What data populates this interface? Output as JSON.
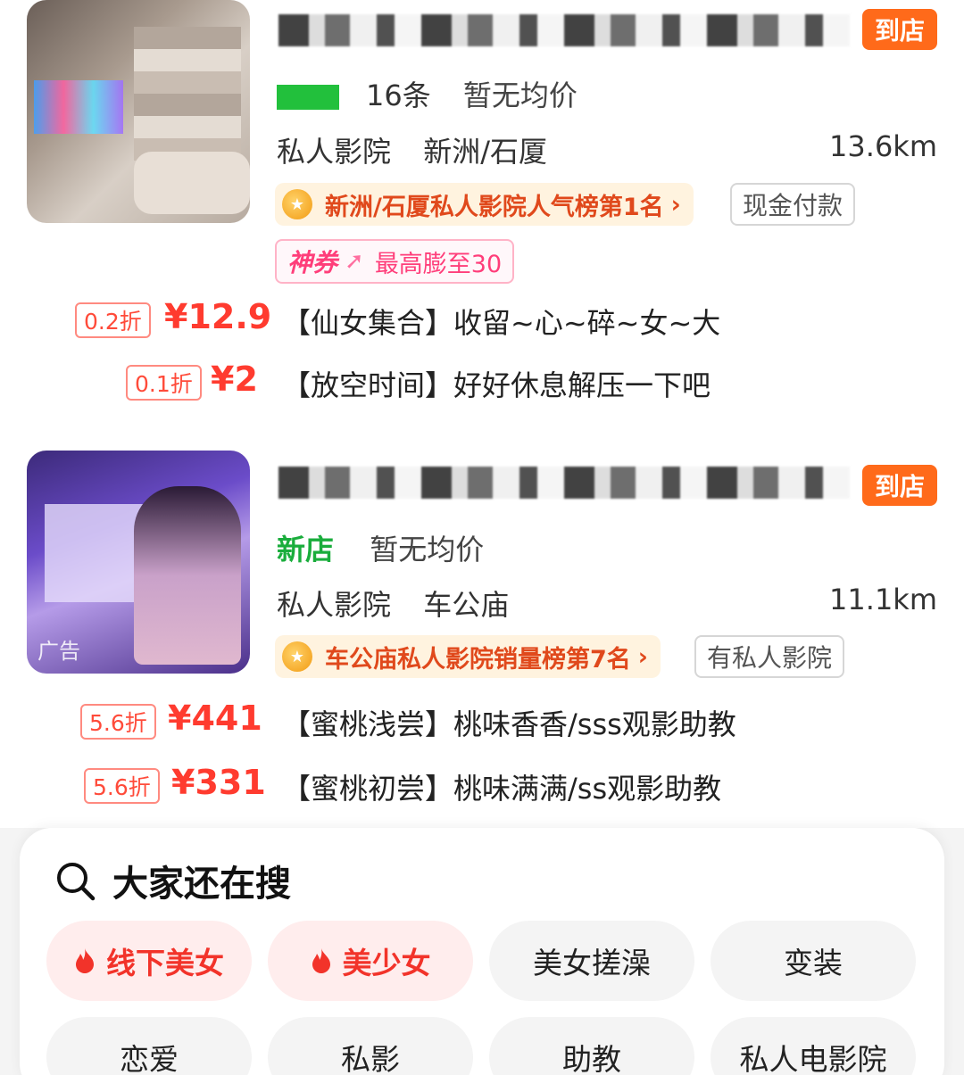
{
  "listings": [
    {
      "title": "",
      "store_badge": "到店",
      "review_count": "16条",
      "avg_price": "暂无均价",
      "category": "私人影院",
      "district": "新洲/石厦",
      "distance": "13.6km",
      "rank": "新洲/石厦私人影院人气榜第1名",
      "tag": "现金付款",
      "coupon": {
        "brand": "神券",
        "text": "最高膨至30"
      },
      "deals": [
        {
          "discount": "0.2折",
          "price": "¥12.9",
          "text": "【仙女集合】收留~心~碎~女~大"
        },
        {
          "discount": "0.1折",
          "price": "¥2",
          "text": "【放空时间】好好休息解压一下吧"
        }
      ]
    },
    {
      "title": "",
      "store_badge": "到店",
      "new_store": "新店",
      "avg_price": "暂无均价",
      "category": "私人影院",
      "district": "车公庙",
      "distance": "11.1km",
      "ad_label": "广告",
      "rank": "车公庙私人影院销量榜第7名",
      "tag": "有私人影院",
      "deals": [
        {
          "discount": "5.6折",
          "price": "¥441",
          "text": "【蜜桃浅尝】桃味香香/sss观影助教"
        },
        {
          "discount": "5.6折",
          "price": "¥331",
          "text": "【蜜桃初尝】桃味满满/ss观影助教"
        }
      ]
    }
  ],
  "search_panel": {
    "title": "大家还在搜",
    "icon": "search-icon",
    "chips": [
      {
        "label": "线下美女",
        "hot": true
      },
      {
        "label": "美少女",
        "hot": true
      },
      {
        "label": "美女搓澡",
        "hot": false
      },
      {
        "label": "变装",
        "hot": false
      },
      {
        "label": "恋爱",
        "hot": false
      },
      {
        "label": "私影",
        "hot": false
      },
      {
        "label": "助教",
        "hot": false
      },
      {
        "label": "私人电影院",
        "hot": false
      }
    ]
  },
  "colors": {
    "accent_orange": "#ff6a1a",
    "price_red": "#ff3b2f",
    "new_green": "#1aad3c",
    "coupon_pink": "#ff3e7a"
  }
}
